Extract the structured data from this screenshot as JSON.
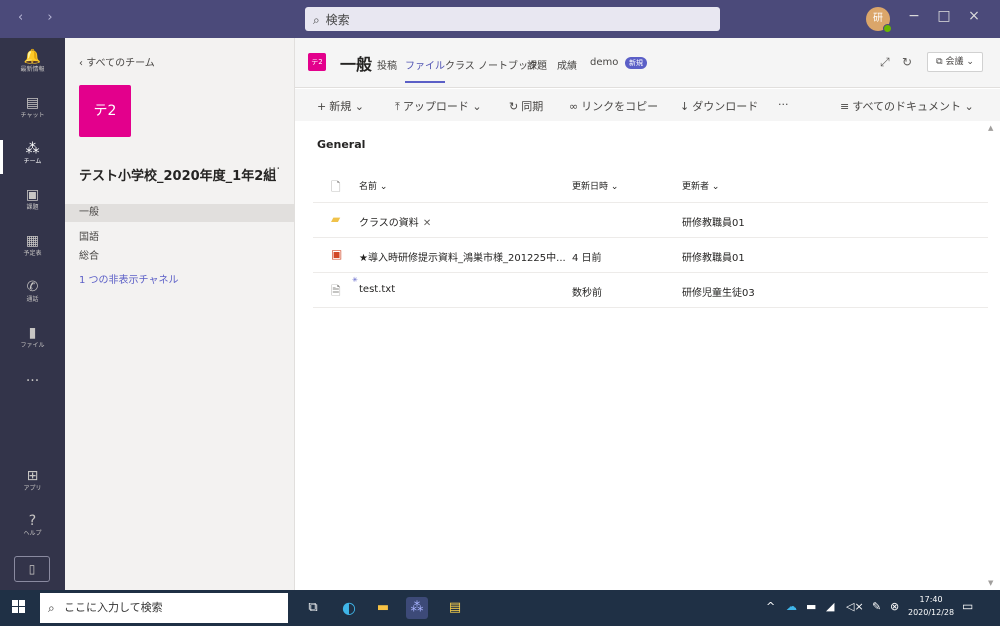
{
  "titlebar": {
    "search_placeholder": "検索",
    "avatar_initial": "研",
    "minimize": "−",
    "maximize": "□",
    "close": "×",
    "nav_arrows": "‹ ›"
  },
  "rail": {
    "items": [
      {
        "label": "最新情報",
        "glyph": "🔔"
      },
      {
        "label": "チャット",
        "glyph": "▤"
      },
      {
        "label": "チーム",
        "glyph": "⁂"
      },
      {
        "label": "課題",
        "glyph": "▣"
      },
      {
        "label": "予定表",
        "glyph": "▦"
      },
      {
        "label": "通話",
        "glyph": "✆"
      },
      {
        "label": "ファイル",
        "glyph": "▮"
      },
      {
        "label": "",
        "glyph": "···"
      },
      {
        "label": "アプリ",
        "glyph": "⊞"
      },
      {
        "label": "ヘルプ",
        "glyph": "?"
      }
    ],
    "device_glyph": "▯"
  },
  "team": {
    "back_label": "すべてのチーム",
    "tile": "テ2",
    "name": "テスト小学校_2020年度_1年2組",
    "more": "···",
    "channels": [
      "一般",
      "国語",
      "総合"
    ],
    "hidden_channels": "1 つの非表示チャネル"
  },
  "header": {
    "tile": "テ2",
    "title": "一般",
    "tabs": [
      "投稿",
      "ファイル",
      "クラス ノートブック",
      "課題",
      "成績",
      "demo"
    ],
    "new_badge": "新規",
    "meet_label": "会議",
    "expand_icon": "⤢",
    "refresh_icon": "↻"
  },
  "toolbar": {
    "new": "新規",
    "upload": "アップロード",
    "sync": "同期",
    "copy_link": "リンクをコピー",
    "download": "ダウンロード",
    "more": "···",
    "all_docs": "すべてのドキュメント"
  },
  "files": {
    "section": "General",
    "columns": {
      "name": "名前",
      "modified": "更新日時",
      "modified_by": "更新者"
    },
    "rows": [
      {
        "name": "クラスの資料",
        "modified": "",
        "modified_by": "研修教職員01"
      },
      {
        "name": "★導入時研修提示資料_鴻巣市様_201225中...",
        "modified": "4 日前",
        "modified_by": "研修教職員01"
      },
      {
        "name": "test.txt",
        "modified": "数秒前",
        "modified_by": "研修児童生徒03"
      }
    ]
  },
  "taskbar": {
    "search_text": "ここに入力して検索",
    "time": "17:40",
    "date": "2020/12/28"
  },
  "colors": {
    "titlebar": "#4b4a7a",
    "rail": "#33344a",
    "team_accent": "#e3008c",
    "brand": "#5b5fc7",
    "taskbar": "#1f3045"
  }
}
